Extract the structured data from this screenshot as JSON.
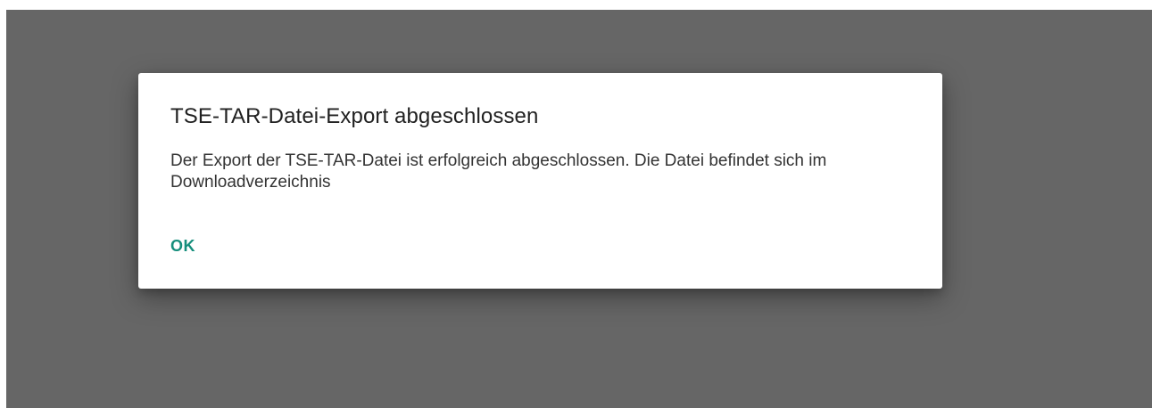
{
  "dialog": {
    "title": "TSE-TAR-Datei-Export abgeschlossen",
    "message": "Der Export der TSE-TAR-Datei ist erfolgreich abgeschlossen. Die Datei befindet sich im Downloadverzeichnis",
    "ok_label": "OK"
  },
  "colors": {
    "scrim": "#666666",
    "dialog_background": "#ffffff",
    "accent": "#158e7c"
  }
}
